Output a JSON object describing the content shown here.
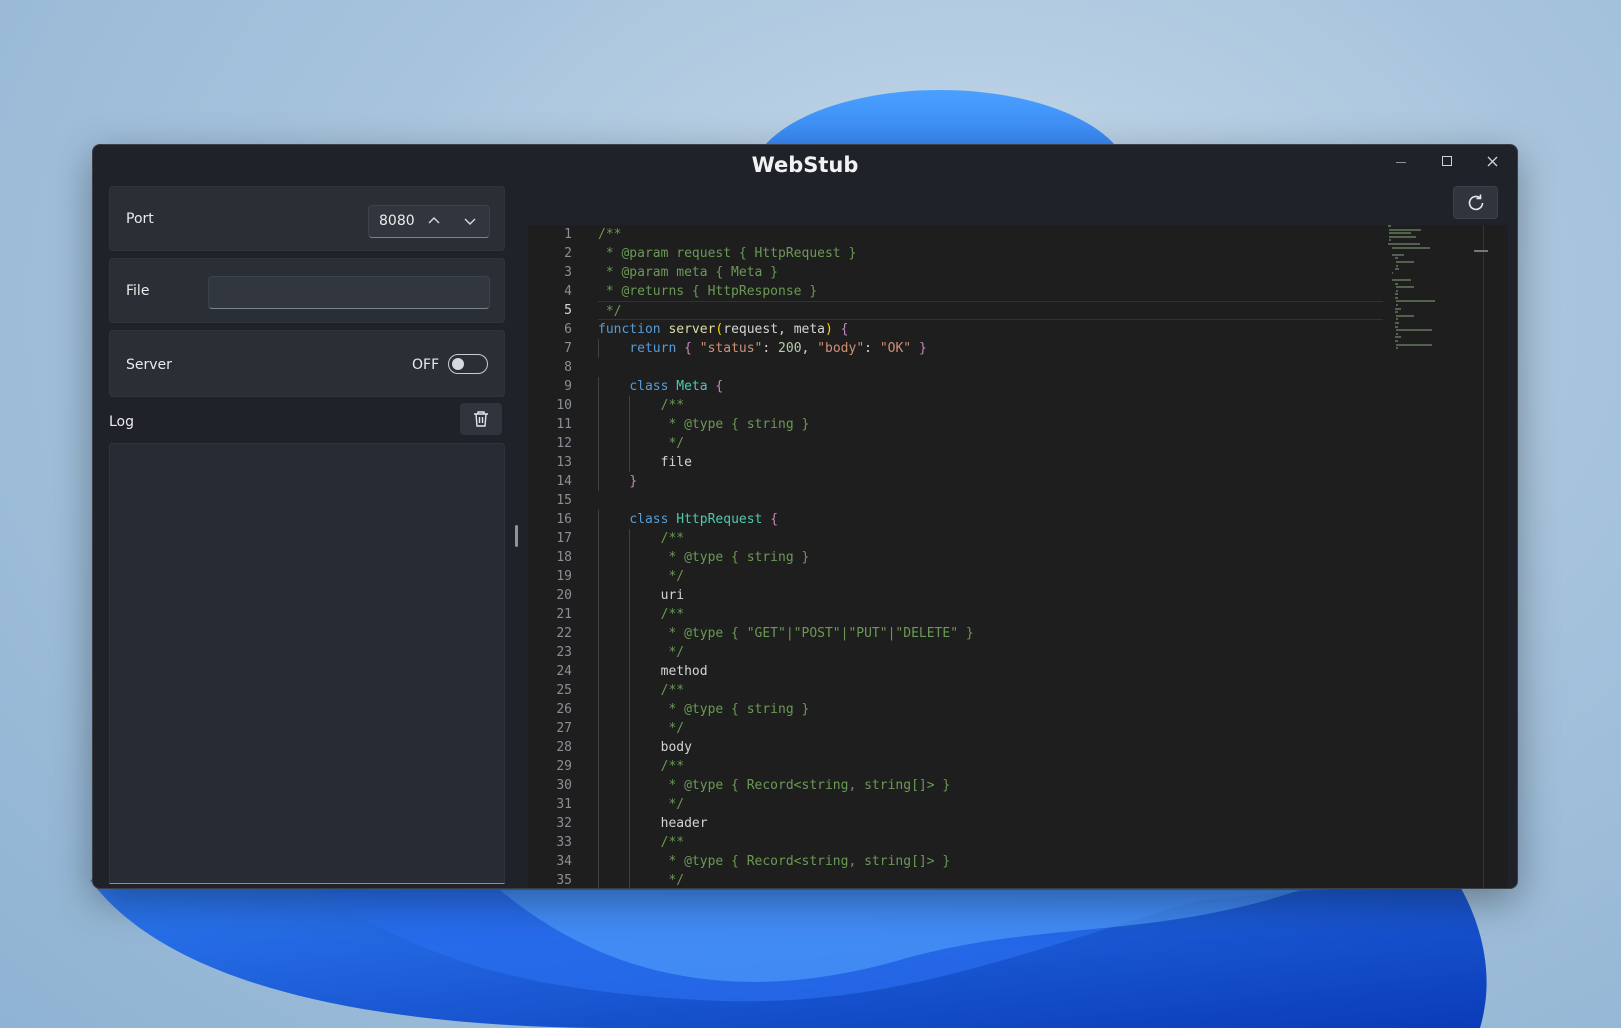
{
  "window": {
    "title": "WebStub"
  },
  "port": {
    "label": "Port",
    "value": "8080"
  },
  "file": {
    "label": "File",
    "value": ""
  },
  "server": {
    "label": "Server",
    "state": "OFF",
    "on": false
  },
  "log": {
    "label": "Log",
    "content": ""
  },
  "editor": {
    "current_line": 5,
    "lines": [
      {
        "n": "1",
        "t": "/**"
      },
      {
        "n": "2",
        "t": " * @param request { HttpRequest }"
      },
      {
        "n": "3",
        "t": " * @param meta { Meta }"
      },
      {
        "n": "4",
        "t": " * @returns { HttpResponse }"
      },
      {
        "n": "5",
        "t": " */"
      },
      {
        "n": "6",
        "t": "function server(request, meta) {"
      },
      {
        "n": "7",
        "t": "    return { \"status\": 200, \"body\": \"OK\" }"
      },
      {
        "n": "8",
        "t": ""
      },
      {
        "n": "9",
        "t": "    class Meta {"
      },
      {
        "n": "10",
        "t": "        /**"
      },
      {
        "n": "11",
        "t": "         * @type { string }"
      },
      {
        "n": "12",
        "t": "         */"
      },
      {
        "n": "13",
        "t": "        file"
      },
      {
        "n": "14",
        "t": "    }"
      },
      {
        "n": "15",
        "t": ""
      },
      {
        "n": "16",
        "t": "    class HttpRequest {"
      },
      {
        "n": "17",
        "t": "        /**"
      },
      {
        "n": "18",
        "t": "         * @type { string }"
      },
      {
        "n": "19",
        "t": "         */"
      },
      {
        "n": "20",
        "t": "        uri"
      },
      {
        "n": "21",
        "t": "        /**"
      },
      {
        "n": "22",
        "t": "         * @type { \"GET\"|\"POST\"|\"PUT\"|\"DELETE\" }"
      },
      {
        "n": "23",
        "t": "         */"
      },
      {
        "n": "24",
        "t": "        method"
      },
      {
        "n": "25",
        "t": "        /**"
      },
      {
        "n": "26",
        "t": "         * @type { string }"
      },
      {
        "n": "27",
        "t": "         */"
      },
      {
        "n": "28",
        "t": "        body"
      },
      {
        "n": "29",
        "t": "        /**"
      },
      {
        "n": "30",
        "t": "         * @type { Record<string, string[]> }"
      },
      {
        "n": "31",
        "t": "         */"
      },
      {
        "n": "32",
        "t": "        header"
      },
      {
        "n": "33",
        "t": "        /**"
      },
      {
        "n": "34",
        "t": "         * @type { Record<string, string[]> }"
      },
      {
        "n": "35",
        "t": "         */"
      }
    ]
  },
  "colors": {
    "comment": "#6a9955",
    "keyword": "#569cd6",
    "function": "#dcdcaa",
    "string": "#ce9178",
    "number": "#b5cea8",
    "class_name": "#4ec9b0",
    "brace": "#c586c0",
    "paren": "#ffd700"
  },
  "icons": {
    "port_up": "chevron-up-icon",
    "port_down": "chevron-down-icon",
    "clear_log": "trash-icon",
    "reload": "refresh-icon"
  }
}
